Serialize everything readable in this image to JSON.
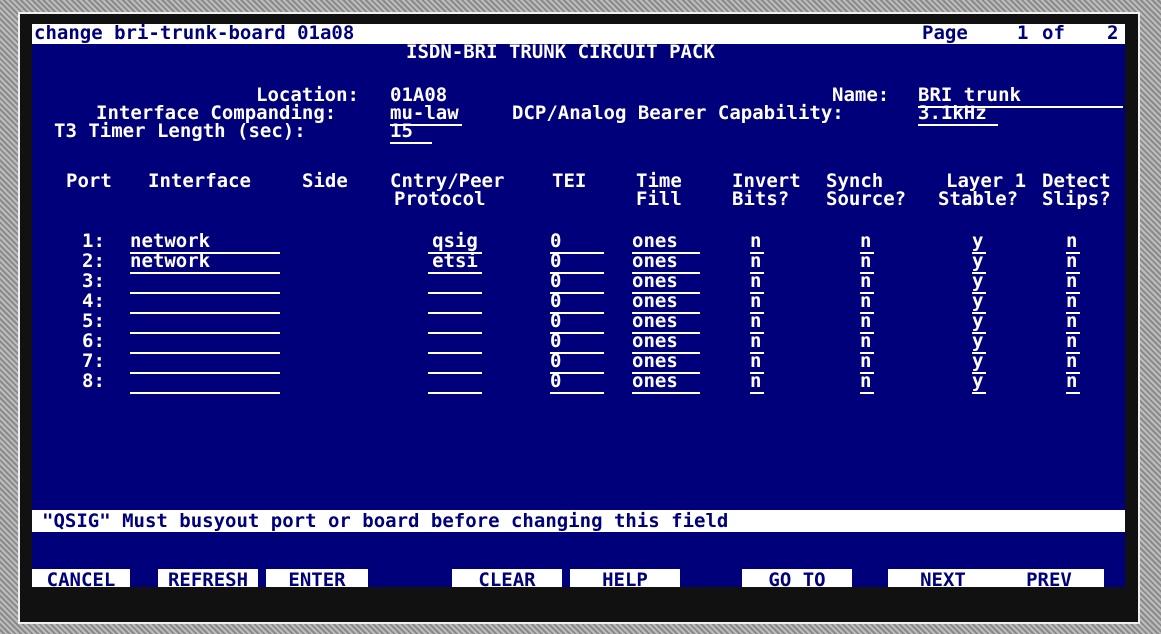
{
  "title": {
    "command": "change bri-trunk-board 01a08",
    "page_label": "Page",
    "page_current": "1",
    "page_of": "of",
    "page_total": "2",
    "heading": "ISDN-BRI TRUNK CIRCUIT PACK"
  },
  "header": {
    "location_label": "Location:",
    "location_value": "01A08",
    "companding_label": "Interface Companding:",
    "companding_value": "mu-law",
    "t3_label": "T3 Timer Length (sec):",
    "t3_value": "15",
    "name_label": "Name:",
    "name_value": "BRI trunk",
    "bearer_label": "DCP/Analog Bearer Capability:",
    "bearer_value": "3.1kHz"
  },
  "columns": {
    "port": "Port",
    "interface": "Interface",
    "side": "Side",
    "cntry_1": "Cntry/Peer",
    "cntry_2": "Protocol",
    "tei": "TEI",
    "timefill_1": "Time",
    "timefill_2": "Fill",
    "invert_1": "Invert",
    "invert_2": "Bits?",
    "synch_1": "Synch",
    "synch_2": "Source?",
    "layer_1": "Layer 1",
    "layer_2": "Stable?",
    "detect_1": "Detect",
    "detect_2": "Slips?"
  },
  "rows": [
    {
      "port": "1:",
      "interface": "network",
      "protocol": "qsig",
      "tei": "0",
      "fill": "ones",
      "invert": "n",
      "synch": "n",
      "stable": "y",
      "slips": "n"
    },
    {
      "port": "2:",
      "interface": "network",
      "protocol": "etsi",
      "tei": "0",
      "fill": "ones",
      "invert": "n",
      "synch": "n",
      "stable": "y",
      "slips": "n"
    },
    {
      "port": "3:",
      "interface": "",
      "protocol": "",
      "tei": "0",
      "fill": "ones",
      "invert": "n",
      "synch": "n",
      "stable": "y",
      "slips": "n"
    },
    {
      "port": "4:",
      "interface": "",
      "protocol": "",
      "tei": "0",
      "fill": "ones",
      "invert": "n",
      "synch": "n",
      "stable": "y",
      "slips": "n"
    },
    {
      "port": "5:",
      "interface": "",
      "protocol": "",
      "tei": "0",
      "fill": "ones",
      "invert": "n",
      "synch": "n",
      "stable": "y",
      "slips": "n"
    },
    {
      "port": "6:",
      "interface": "",
      "protocol": "",
      "tei": "0",
      "fill": "ones",
      "invert": "n",
      "synch": "n",
      "stable": "y",
      "slips": "n"
    },
    {
      "port": "7:",
      "interface": "",
      "protocol": "",
      "tei": "0",
      "fill": "ones",
      "invert": "n",
      "synch": "n",
      "stable": "y",
      "slips": "n"
    },
    {
      "port": "8:",
      "interface": "",
      "protocol": "",
      "tei": "0",
      "fill": "ones",
      "invert": "n",
      "synch": "n",
      "stable": "y",
      "slips": "n"
    }
  ],
  "message": "\"QSIG\" Must busyout port or board before changing this field",
  "fkeys": {
    "cancel": "CANCEL",
    "refresh": "REFRESH",
    "enter": "ENTER",
    "clear_field": "CLEAR\nFIELD",
    "help": "HELP",
    "go_to_page": "GO TO\nPAGE",
    "next_page": "NEXT\nPAGE",
    "prev_page": "PREV\nPAGE"
  },
  "colors": {
    "screen_bg": "#00007a",
    "text": "#ffffff"
  }
}
